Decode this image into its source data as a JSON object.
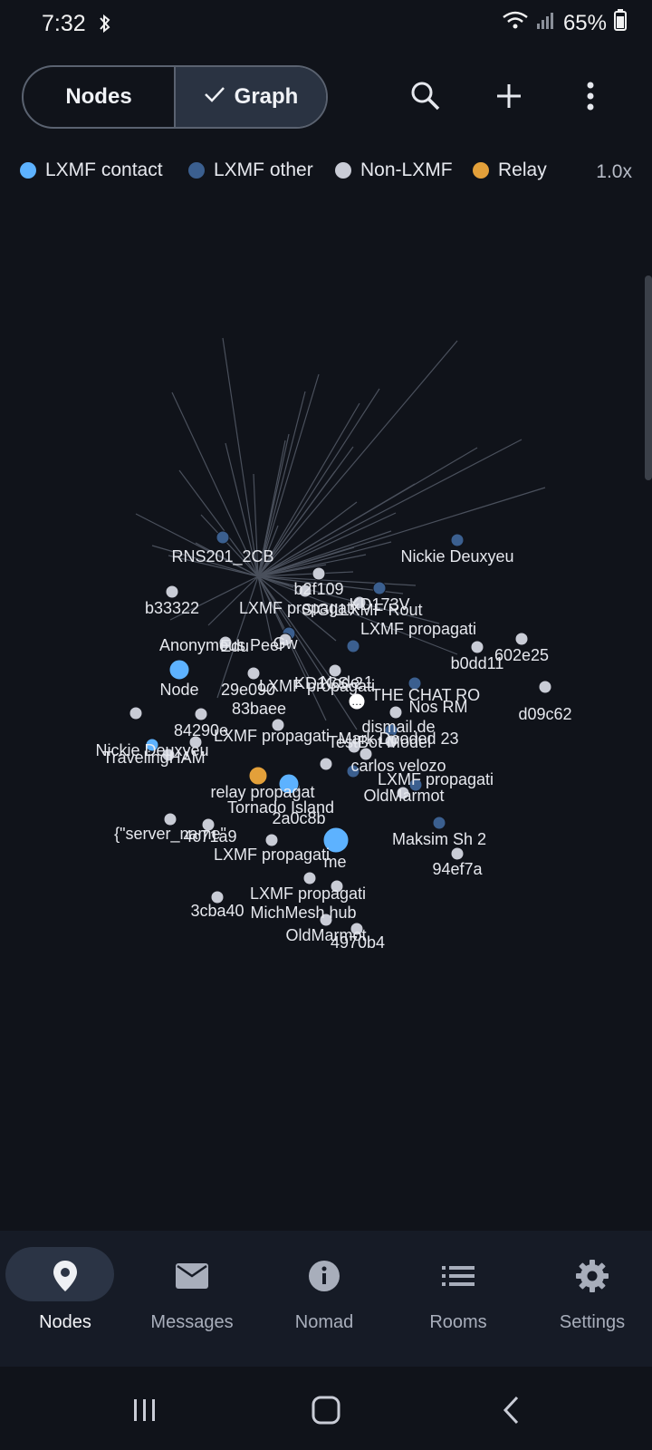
{
  "status": {
    "time": "7:32",
    "battery": "65%"
  },
  "view_toggle": {
    "nodes_label": "Nodes",
    "graph_label": "Graph",
    "selected": "Graph"
  },
  "toolbar": {
    "search_icon": "search-icon",
    "add_icon": "plus-icon",
    "more_icon": "more-vert-icon"
  },
  "legend": {
    "items": [
      {
        "label": "LXMF contact",
        "color": "#5db2ff"
      },
      {
        "label": "LXMF other",
        "color": "#3b5f8f"
      },
      {
        "label": "Non-LXMF",
        "color": "#c9ccd6"
      },
      {
        "label": "Relay",
        "color": "#e3a03a"
      }
    ],
    "zoom": "1.0x"
  },
  "graph": {
    "nodes": [
      {
        "label": "",
        "type": "relay"
      },
      {
        "label": "RNS201_2CB",
        "type": "lxmf_other"
      },
      {
        "label": "Nickie Deuxyeu",
        "type": "lxmf_other"
      },
      {
        "label": "b33322",
        "type": "non_lxmf"
      },
      {
        "label": "b2f109",
        "type": "non_lxmf"
      },
      {
        "label": "KD173V",
        "type": "lxmf_other"
      },
      {
        "label": "LXMF propagati",
        "type": "non_lxmf"
      },
      {
        "label": "Anonymous Peer",
        "type": "lxmf_contact"
      },
      {
        "label": "LXMF propagati",
        "type": "lxmf_other"
      },
      {
        "label": "b0dd11",
        "type": "non_lxmf"
      },
      {
        "label": "602e25",
        "type": "non_lxmf"
      },
      {
        "label": "Node",
        "type": "non_lxmf"
      },
      {
        "label": "29e090",
        "type": "non_lxmf"
      },
      {
        "label": "THE CHAT RO",
        "type": "relay_chat"
      },
      {
        "label": "d09c62",
        "type": "non_lxmf"
      },
      {
        "label": "LXMF propagati",
        "type": "non_lxmf"
      },
      {
        "label": "83baee",
        "type": "non_lxmf"
      },
      {
        "label": "84290e",
        "type": "non_lxmf"
      },
      {
        "label": "Nos RM",
        "type": "non_lxmf"
      },
      {
        "label": "dismail.de",
        "type": "lxmf_other"
      },
      {
        "label": "Nickie Deuxyeu",
        "type": "lxmf_contact"
      },
      {
        "label": "TravelingHAM",
        "type": "non_lxmf"
      },
      {
        "label": "LXMF propagati",
        "type": "non_lxmf"
      },
      {
        "label": "TestBot Model",
        "type": "non_lxmf"
      },
      {
        "label": "Mark Dooded 23",
        "type": "non_lxmf"
      },
      {
        "label": "carlos velozo",
        "type": "lxmf_other"
      },
      {
        "label": "LXMF propagati",
        "type": "lxmf_other"
      },
      {
        "label": "OldMarmot",
        "type": "non_lxmf"
      },
      {
        "label": "{\"server_name\"",
        "type": "non_lxmf"
      },
      {
        "label": "4c71a9",
        "type": "non_lxmf"
      },
      {
        "label": "LXMF propagati",
        "type": "non_lxmf"
      },
      {
        "label": "relay propagat",
        "type": "non_lxmf"
      },
      {
        "label": "Tornado Island",
        "type": "lxmf_contact"
      },
      {
        "label": "Maksim Sh 2",
        "type": "lxmf_other"
      },
      {
        "label": "94ef7a",
        "type": "non_lxmf"
      },
      {
        "label": "me",
        "type": "lxmf_contact"
      },
      {
        "label": "3cba40",
        "type": "non_lxmf"
      },
      {
        "label": "LXMF propagati",
        "type": "non_lxmf"
      },
      {
        "label": "MichMesh hub",
        "type": "non_lxmf"
      },
      {
        "label": "OldMarmot",
        "type": "non_lxmf"
      },
      {
        "label": "4970b4",
        "type": "non_lxmf"
      },
      {
        "label": "LXMF Rout",
        "type": "non_lxmf"
      },
      {
        "label": "SIGIL",
        "type": "lxmf_other"
      },
      {
        "label": "KD1CS-2",
        "type": "lxmf_other"
      },
      {
        "label": "Node 1",
        "type": "non_lxmf"
      },
      {
        "label": "2a0c8b",
        "type": "non_lxmf"
      },
      {
        "label": "Gw",
        "type": "non_lxmf"
      },
      {
        "label": "Edu",
        "type": "non_lxmf"
      }
    ]
  },
  "bottom_nav": {
    "items": [
      {
        "label": "Nodes",
        "icon": "map-pin-icon",
        "active": true
      },
      {
        "label": "Messages",
        "icon": "mail-icon",
        "active": false
      },
      {
        "label": "Nomad",
        "icon": "info-icon",
        "active": false
      },
      {
        "label": "Rooms",
        "icon": "list-icon",
        "active": false
      },
      {
        "label": "Settings",
        "icon": "gear-icon",
        "active": false
      }
    ]
  }
}
